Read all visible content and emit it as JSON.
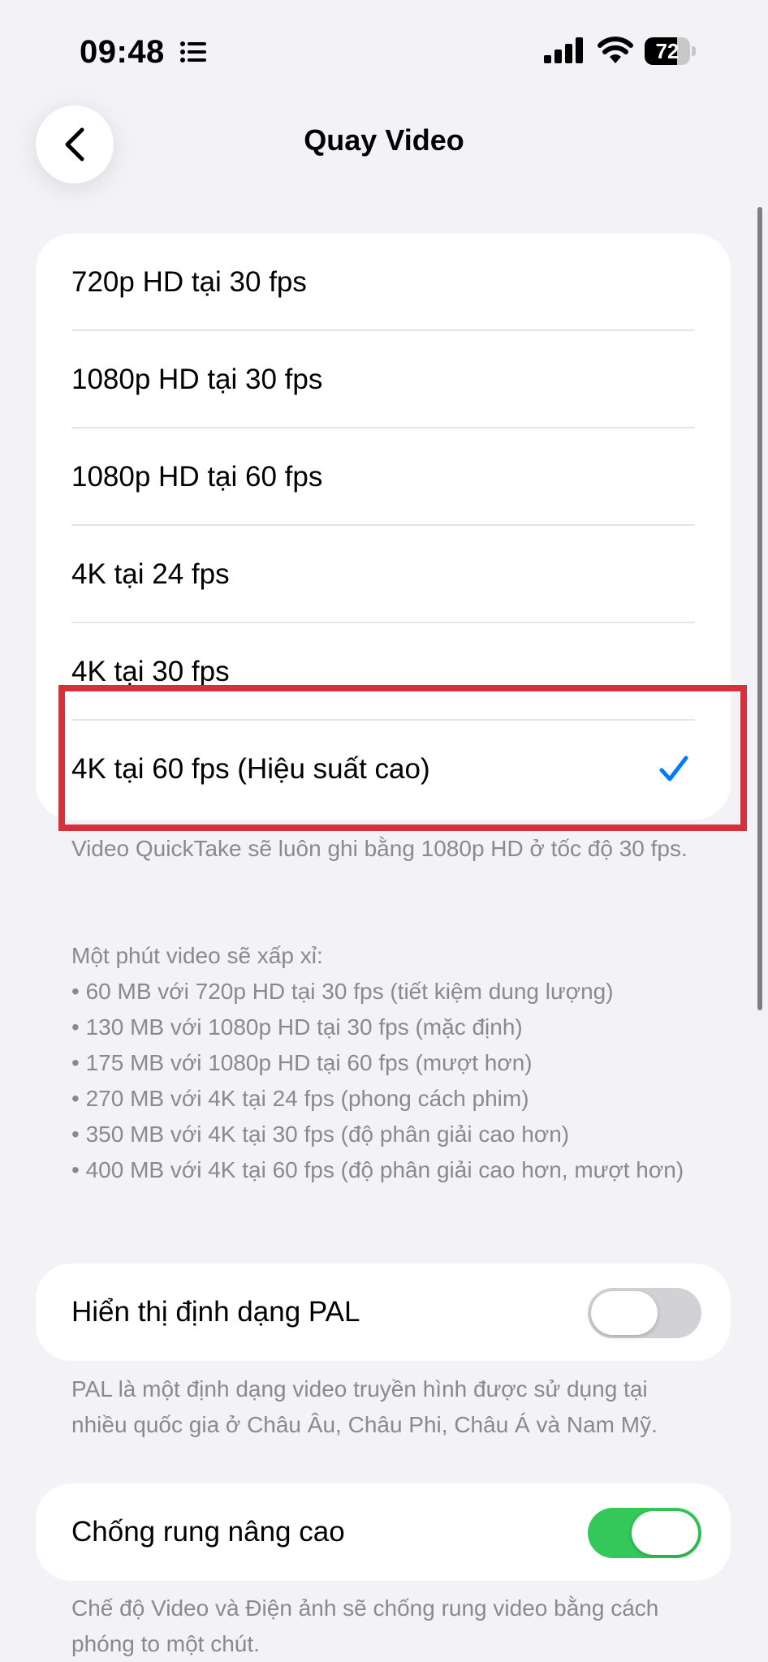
{
  "status_bar": {
    "time": "09:48",
    "battery": "72",
    "battery_level": 0.72
  },
  "nav": {
    "title": "Quay Video"
  },
  "video_options": [
    {
      "label": "720p HD tại 30 fps",
      "selected": false
    },
    {
      "label": "1080p HD tại 30 fps",
      "selected": false
    },
    {
      "label": "1080p HD tại 60 fps",
      "selected": false
    },
    {
      "label": "4K tại 24 fps",
      "selected": false
    },
    {
      "label": "4K tại 30 fps",
      "selected": false
    },
    {
      "label": "4K tại 60 fps (Hiệu suất cao)",
      "selected": true
    }
  ],
  "quicktake_note": "Video QuickTake sẽ luôn ghi bằng 1080p HD ở tốc độ 30 fps.",
  "size_info": {
    "heading": "Một phút video sẽ xấp xỉ:",
    "lines": [
      "• 60 MB với 720p HD tại 30 fps (tiết kiệm dung lượng)",
      "• 130 MB với 1080p HD tại 30 fps (mặc định)",
      "• 175 MB với 1080p HD tại 60 fps (mượt hơn)",
      "• 270 MB với 4K tại 24 fps (phong cách phim)",
      "• 350 MB với 4K tại 30 fps (độ phân giải cao hơn)",
      "• 400 MB với 4K tại 60 fps (độ phân giải cao hơn, mượt hơn)"
    ]
  },
  "pal_setting": {
    "label": "Hiển thị định dạng PAL",
    "enabled": false,
    "note": "PAL là một định dạng video truyền hình được sử dụng tại nhiều quốc gia ở Châu Âu, Châu Phi, Châu Á và Nam Mỹ."
  },
  "stabilization_setting": {
    "label": "Chống rung nâng cao",
    "enabled": true,
    "note": "Chế độ Video và Điện ảnh sẽ chống rung video bằng cách phóng to một chút."
  },
  "colors": {
    "accent": "#007aff",
    "toggle_on": "#34c759",
    "toggle_off": "#d1d1d6",
    "highlight": "#d5313d"
  }
}
